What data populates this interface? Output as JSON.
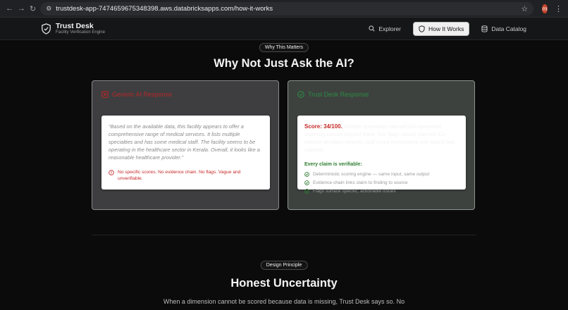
{
  "browser": {
    "url": "trustdesk-app-7474659675348398.aws.databricksapps.com/how-it-works",
    "avatar_letter": "m"
  },
  "app": {
    "name": "Trust Desk",
    "tagline": "Facility Verification Engine",
    "nav": [
      {
        "label": "Explorer",
        "icon": "search-icon"
      },
      {
        "label": "How It Works",
        "icon": "shield-icon",
        "active": true
      },
      {
        "label": "Data Catalog",
        "icon": "database-icon"
      }
    ]
  },
  "section1": {
    "pill": "Why This Matters",
    "heading": "Why Not Just Ask the AI?",
    "generic": {
      "title": "Generic AI Response",
      "quote": "“Based on the available data, this facility appears to offer a comprehensive range of medical services. It lists multiple specialties and has some medical staff. The facility seems to be operating in the healthcare sector in Kerala. Overall, it looks like a reasonable healthcare provider.”",
      "warning": "No specific scores. No evidence chain. No flags. Vague and unverifiable."
    },
    "trustdesk": {
      "title": "Trust Desk Response",
      "score": "Score: 34/100.",
      "score_detail": "Multiple specialties claimed but equipment inventory cannot support them. Two flags raised: claimed ICU without ventilator records; staff count inconsistent with stated bed capacity.",
      "verifiable_title": "Every claim is verifiable:",
      "checks": [
        "Deterministic scoring engine — same input, same output",
        "Evidence chain links claim to finding to source",
        "Flags surface specific, actionable issues"
      ]
    }
  },
  "section2": {
    "pill": "Design Principle",
    "heading": "Honest Uncertainty",
    "paragraph": "When a dimension cannot be scored because data is missing, Trust Desk says so. No"
  },
  "colors": {
    "danger": "#c62828",
    "success": "#2e7d32",
    "background": "#0b0b0c"
  }
}
